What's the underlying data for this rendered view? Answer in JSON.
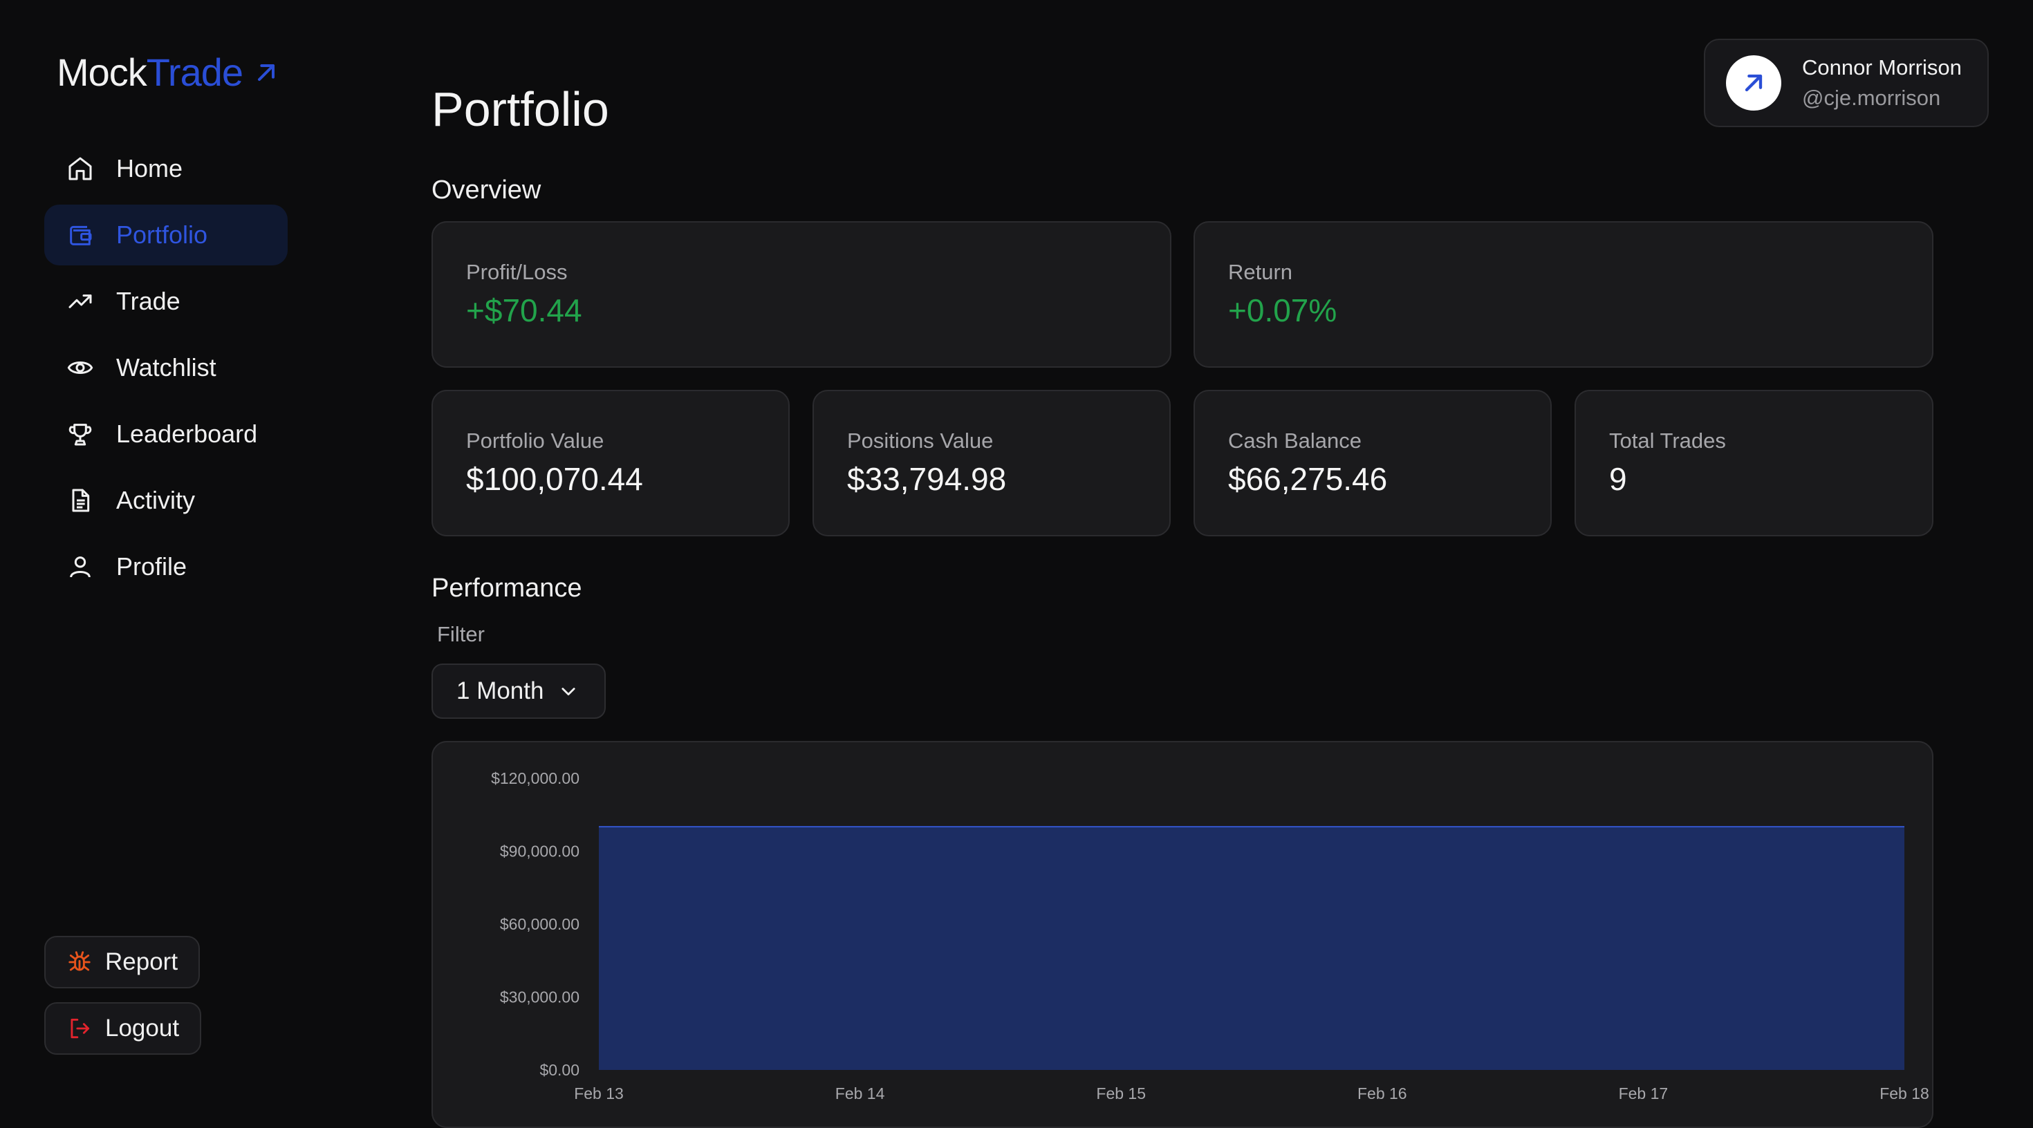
{
  "brand": {
    "part1": "Mock",
    "part2": "Trade",
    "icon": "arrow-up-right-icon",
    "color": "#2a4ed6"
  },
  "nav": [
    {
      "label": "Home",
      "icon": "home-icon",
      "active": false
    },
    {
      "label": "Portfolio",
      "icon": "wallet-icon",
      "active": true
    },
    {
      "label": "Trade",
      "icon": "trending-up-icon",
      "active": false
    },
    {
      "label": "Watchlist",
      "icon": "eye-icon",
      "active": false
    },
    {
      "label": "Leaderboard",
      "icon": "trophy-icon",
      "active": false
    },
    {
      "label": "Activity",
      "icon": "document-icon",
      "active": false
    },
    {
      "label": "Profile",
      "icon": "user-icon",
      "active": false
    }
  ],
  "actions": {
    "report": "Report",
    "logout": "Logout"
  },
  "user": {
    "name": "Connor Morrison",
    "handle": "@cje.morrison"
  },
  "page": {
    "title": "Portfolio"
  },
  "overview": {
    "title": "Overview",
    "profit_loss": {
      "label": "Profit/Loss",
      "value": "+$70.44"
    },
    "return": {
      "label": "Return",
      "value": "+0.07%"
    },
    "portfolio_value": {
      "label": "Portfolio Value",
      "value": "$100,070.44"
    },
    "positions_value": {
      "label": "Positions Value",
      "value": "$33,794.98"
    },
    "cash_balance": {
      "label": "Cash Balance",
      "value": "$66,275.46"
    },
    "total_trades": {
      "label": "Total Trades",
      "value": "9"
    }
  },
  "performance": {
    "title": "Performance",
    "filter_label": "Filter",
    "filter_value": "1 Month"
  },
  "colors": {
    "positive": "#22a34b",
    "accent": "#2f55e0",
    "area_fill": "#1c2d63",
    "area_line": "#3355cc"
  },
  "chart_data": {
    "type": "area",
    "x": [
      "Feb 13",
      "Feb 14",
      "Feb 15",
      "Feb 16",
      "Feb 17",
      "Feb 18"
    ],
    "values": [
      100070.44,
      100070.44,
      100070.44,
      100070.44,
      100070.44,
      100070.44
    ],
    "ylim": [
      0,
      120000
    ],
    "yticks": [
      0,
      30000,
      60000,
      90000,
      120000
    ],
    "ytick_labels": [
      "$0.00",
      "$30,000.00",
      "$60,000.00",
      "$90,000.00",
      "$120,000.00"
    ],
    "grid": false
  }
}
